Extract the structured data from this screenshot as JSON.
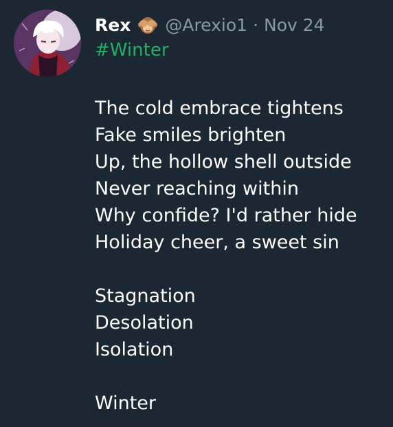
{
  "tweet": {
    "display_name": "Rex",
    "handle": "@Arexio1",
    "separator": "·",
    "date": "Nov 24",
    "hashtag": "#Winter",
    "stanzas": [
      [
        "The cold embrace tightens",
        "Fake smiles brighten",
        "Up, the hollow shell outside",
        "Never reaching within",
        "Why confide? I'd rather hide",
        "Holiday cheer, a sweet sin"
      ],
      [
        "Stagnation",
        "Desolation",
        "Isolation"
      ],
      [
        "Winter"
      ]
    ]
  },
  "icons": {
    "name_emoji": "see-no-evil-monkey-icon"
  },
  "colors": {
    "background": "#1b2733",
    "muted_text": "#8899a6",
    "hashtag": "#22b061",
    "text": "#ffffff"
  }
}
